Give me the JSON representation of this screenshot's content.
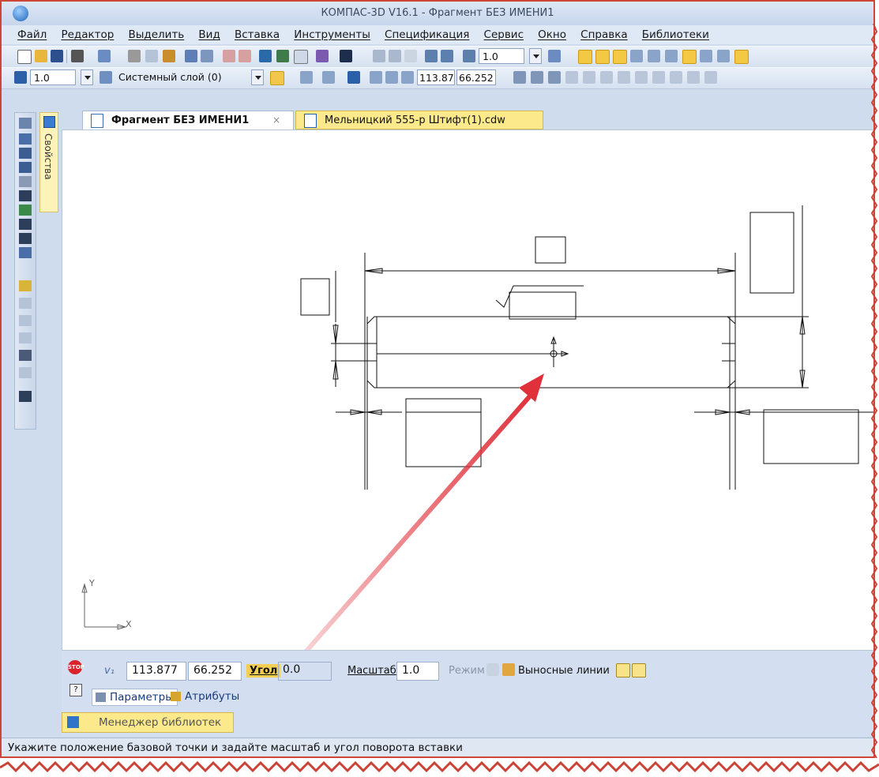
{
  "window": {
    "title": "КОМПАС-3D V16.1 - Фрагмент БЕЗ ИМЕНИ1"
  },
  "menu": [
    "Файл",
    "Редактор",
    "Выделить",
    "Вид",
    "Вставка",
    "Инструменты",
    "Спецификация",
    "Сервис",
    "Окно",
    "Справка",
    "Библиотеки"
  ],
  "toolbar1": {
    "zoom_value": "1.0"
  },
  "toolbar2": {
    "step_value": "1.0",
    "layer_value": "Системный слой (0)",
    "coord_x": "113.87",
    "coord_y": "66.252"
  },
  "left_panel": {
    "properties_label": "Свойства"
  },
  "tabs": [
    {
      "label": "Фрагмент БЕЗ ИМЕНИ1",
      "close": "×"
    },
    {
      "label": "Мельницкий 555-р Штифт(1).cdw"
    }
  ],
  "canvas": {
    "axis_y": "Y",
    "axis_x": "X"
  },
  "params": {
    "x": "113.877",
    "y": "66.252",
    "angle_label": "Угол",
    "angle_value": "0.0",
    "scale_label": "Масштаб",
    "scale_value": "1.0",
    "mode_label": "Режим",
    "ext_lines_label": "Выносные линии",
    "tab_params": "Параметры",
    "tab_attrs": "Атрибуты"
  },
  "library_manager": "Менеджер библиотек",
  "status": "Укажите положение базовой точки и задайте масштаб и угол поворота вставки",
  "colors": {
    "frame": "#d0453a",
    "arrow": "#e0303a",
    "accent_yellow": "#fbe98c"
  }
}
